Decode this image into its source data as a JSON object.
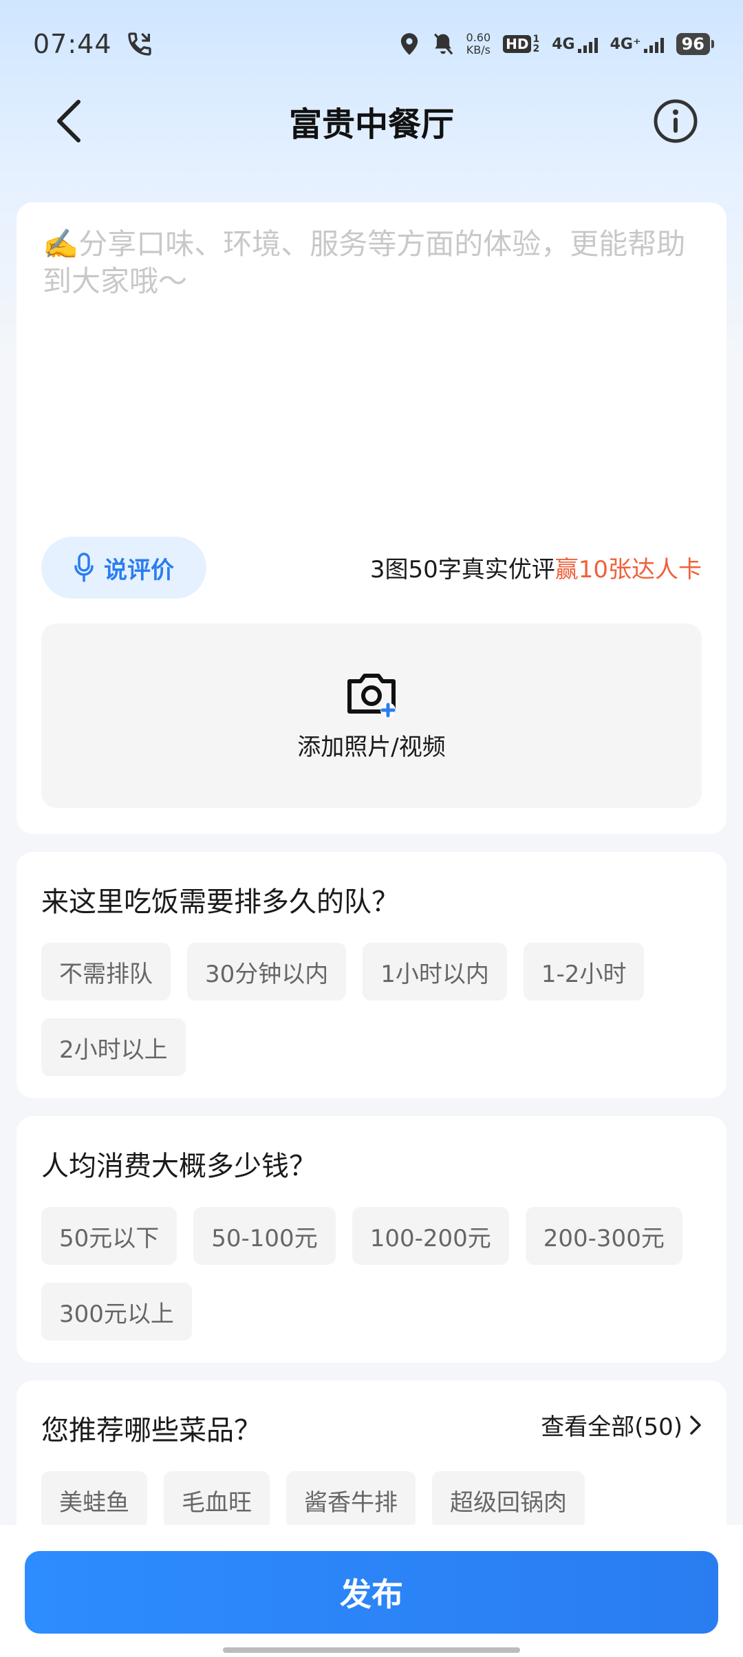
{
  "status_bar": {
    "time": "07:44",
    "net_speed_value": "0.60",
    "net_speed_unit": "KB/s",
    "hd_label": "HD",
    "sim_1": "1",
    "sim_2": "2",
    "network_1": "4G",
    "network_2": "4G⁺",
    "battery": "96"
  },
  "header": {
    "title": "富贵中餐厅"
  },
  "review": {
    "placeholder": "✍️分享口味、环境、服务等方面的体验，更能帮助到大家哦～",
    "voice_label": "说评价",
    "promo_prefix": "3图50字真实优评",
    "promo_accent": "赢10张达人卡",
    "upload_label": "添加照片/视频"
  },
  "queue": {
    "question": "来这里吃饭需要排多久的队？",
    "options": [
      "不需排队",
      "30分钟以内",
      "1小时以内",
      "1-2小时",
      "2小时以上"
    ]
  },
  "price": {
    "question": "人均消费大概多少钱？",
    "options": [
      "50元以下",
      "50-100元",
      "100-200元",
      "200-300元",
      "300元以上"
    ]
  },
  "dishes": {
    "question": "您推荐哪些菜品？",
    "view_all": "查看全部(50)",
    "options": [
      "美蛙鱼",
      "毛血旺",
      "酱香牛排",
      "超级回锅肉"
    ]
  },
  "footer": {
    "publish_label": "发布"
  },
  "colors": {
    "accent_blue": "#2a7df0",
    "promo_orange": "#f0603a"
  }
}
